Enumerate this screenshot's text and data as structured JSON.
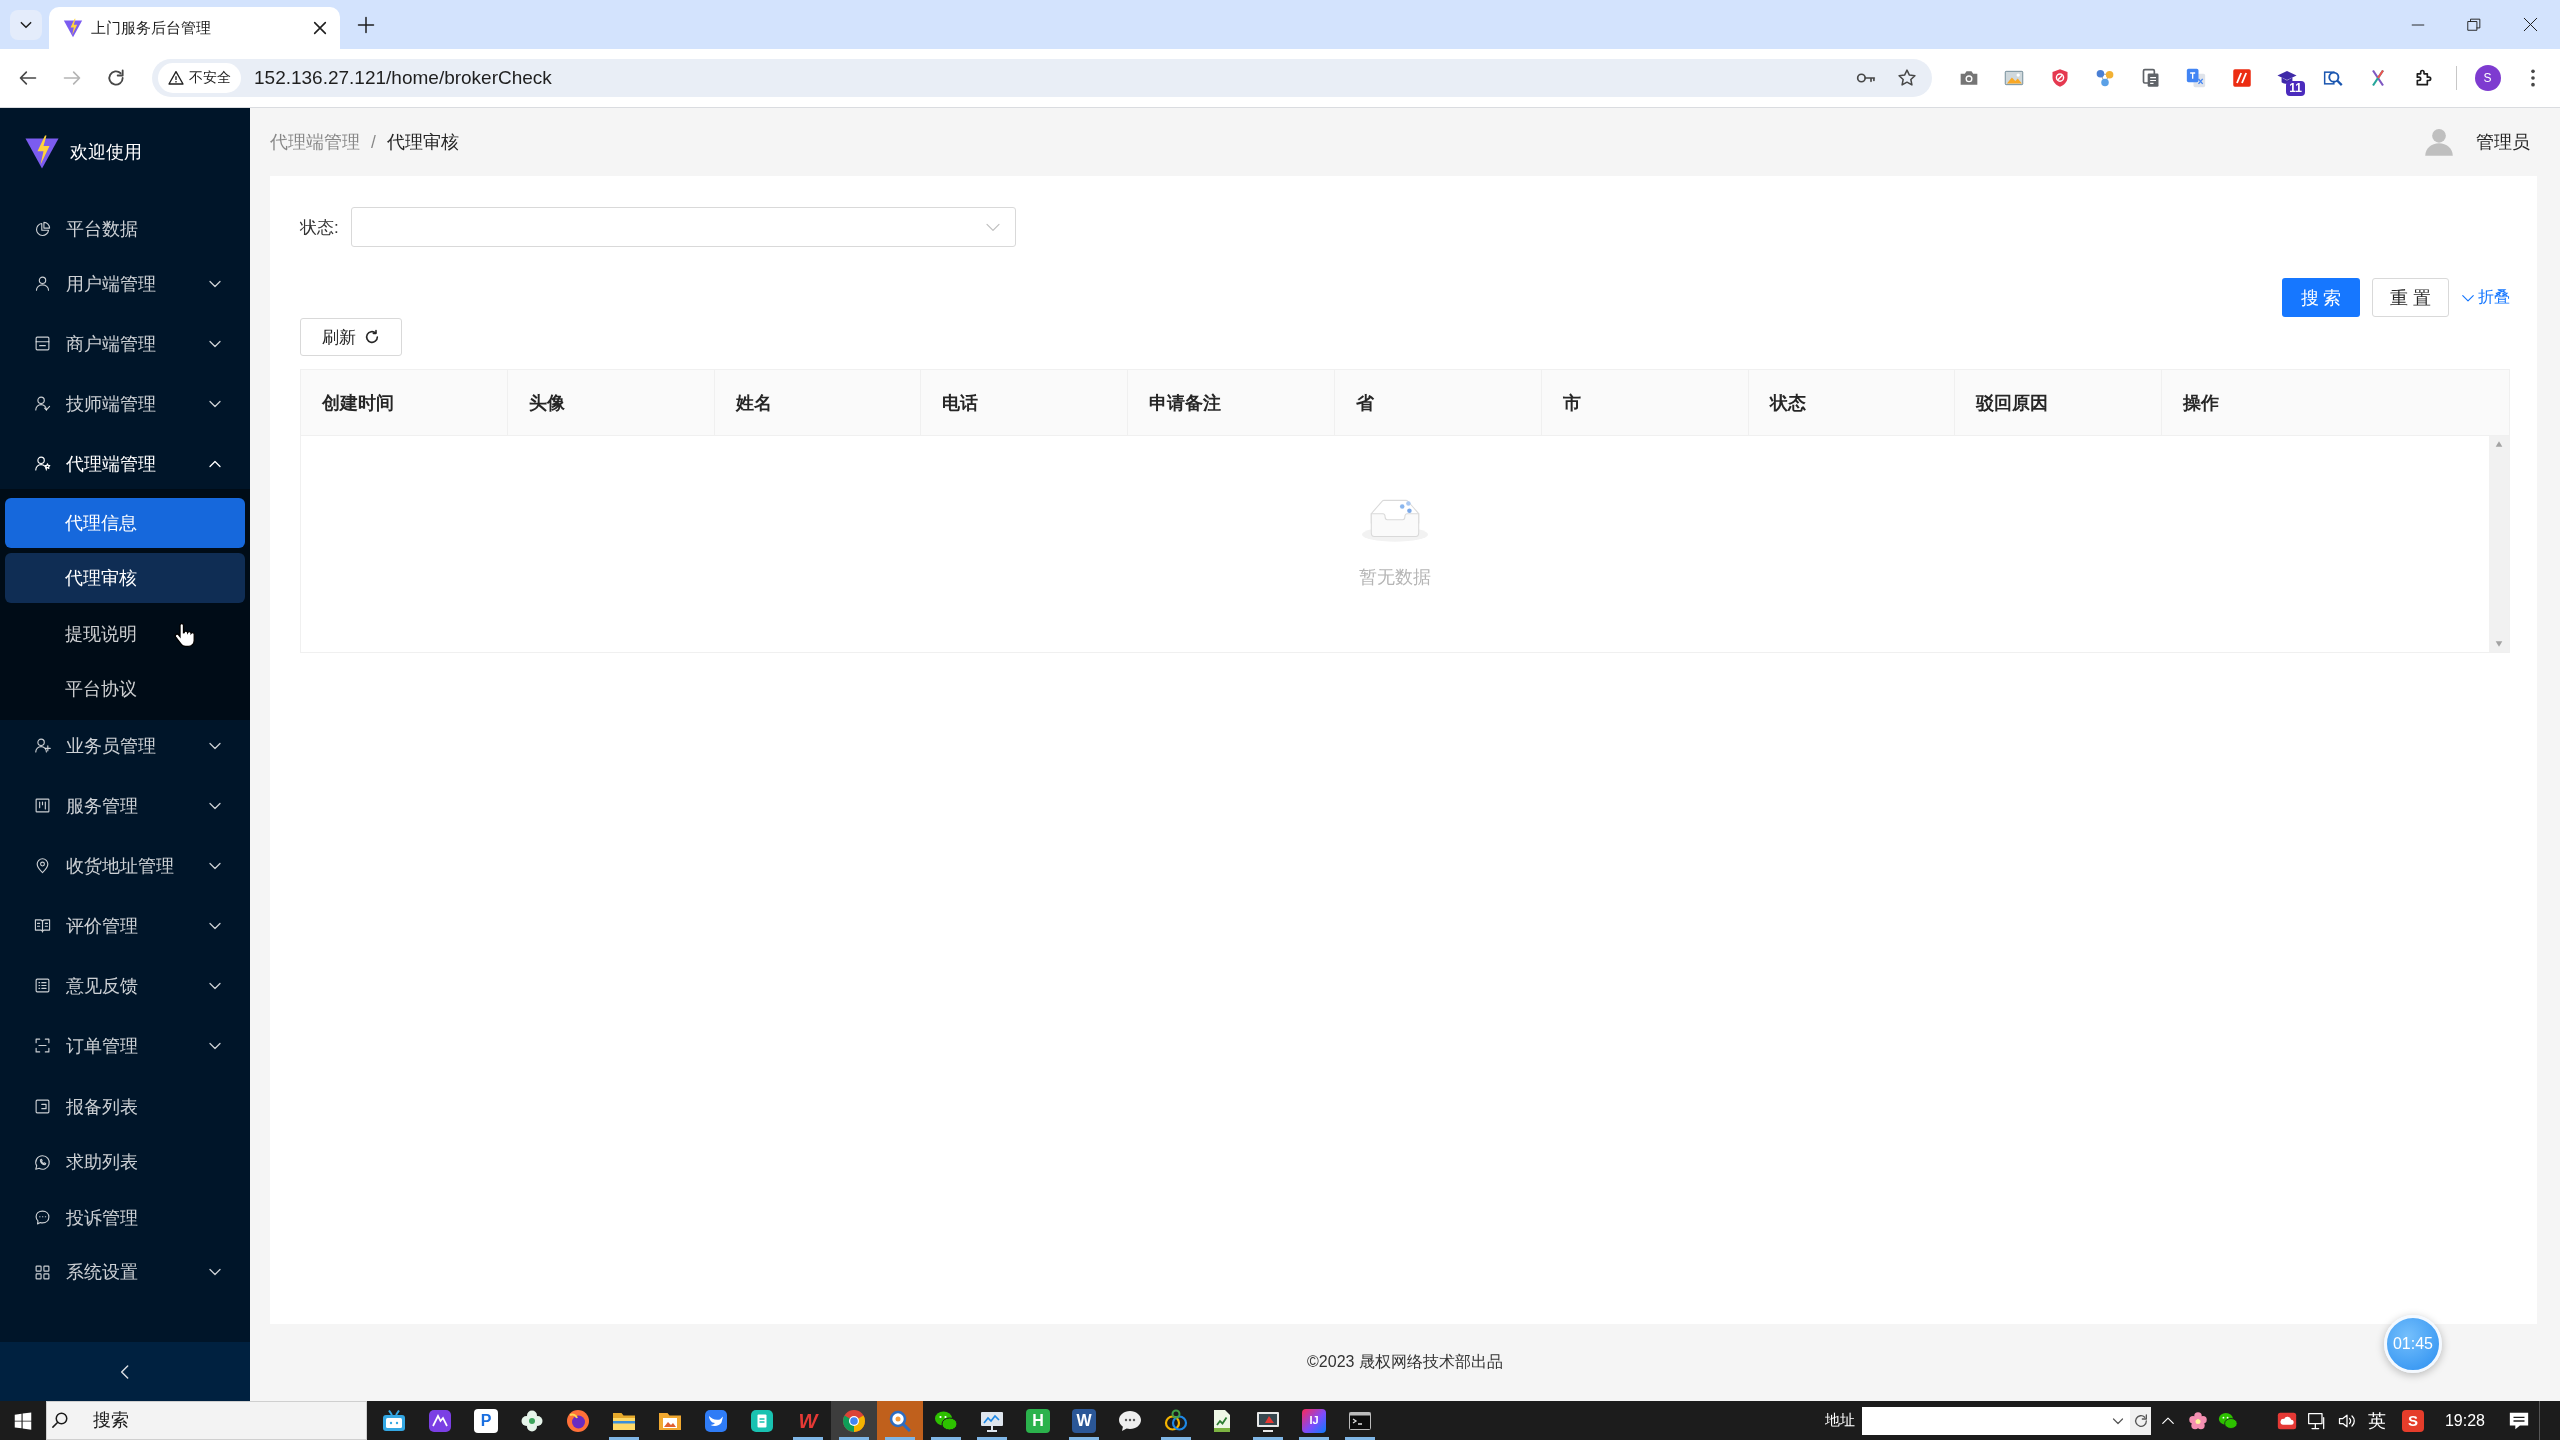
{
  "browser": {
    "tab_title": "上门服务后台管理",
    "security_label": "不安全",
    "url": "152.136.27.121/home/brokerCheck",
    "extension_badge": "11",
    "profile_initial": "S"
  },
  "sidebar": {
    "title": "欢迎使用",
    "items": [
      {
        "kind": "item",
        "label": "平台数据",
        "selected": false
      },
      {
        "kind": "submenu",
        "label": "用户端管理",
        "selected": false,
        "expanded": false
      },
      {
        "kind": "submenu",
        "label": "商户端管理",
        "selected": false,
        "expanded": false
      },
      {
        "kind": "submenu",
        "label": "技师端管理",
        "selected": false,
        "expanded": false
      },
      {
        "kind": "submenu",
        "label": "代理端管理",
        "selected": false,
        "expanded": true,
        "children": [
          {
            "label": "代理信息",
            "selected": true,
            "highlighted": false
          },
          {
            "label": "代理审核",
            "selected": false,
            "highlighted": true
          },
          {
            "label": "提现说明",
            "selected": false,
            "highlighted": false
          },
          {
            "label": "平台协议",
            "selected": false,
            "highlighted": false
          }
        ]
      },
      {
        "kind": "submenu",
        "label": "业务员管理",
        "selected": false,
        "expanded": false
      },
      {
        "kind": "submenu",
        "label": "服务管理",
        "selected": false,
        "expanded": false
      },
      {
        "kind": "submenu",
        "label": "收货地址管理",
        "selected": false,
        "expanded": false
      },
      {
        "kind": "submenu",
        "label": "评价管理",
        "selected": false,
        "expanded": false
      },
      {
        "kind": "submenu",
        "label": "意见反馈",
        "selected": false,
        "expanded": false
      },
      {
        "kind": "submenu",
        "label": "订单管理",
        "selected": false,
        "expanded": false
      },
      {
        "kind": "item",
        "label": "报备列表",
        "selected": false
      },
      {
        "kind": "item",
        "label": "求助列表",
        "selected": false
      },
      {
        "kind": "item",
        "label": "投诉管理",
        "selected": false
      },
      {
        "kind": "submenu",
        "label": "系统设置",
        "selected": false,
        "expanded": false
      }
    ]
  },
  "header": {
    "breadcrumb": [
      "代理端管理",
      "代理审核"
    ],
    "separator": "/",
    "user_name": "管理员"
  },
  "filter": {
    "label": "状态:"
  },
  "actions": {
    "search": "搜 索",
    "reset": "重 置",
    "collapse": "折叠"
  },
  "table_toolbar": {
    "refresh": "刷新"
  },
  "table": {
    "columns": [
      "创建时间",
      "头像",
      "姓名",
      "电话",
      "申请备注",
      "省",
      "市",
      "状态",
      "驳回原因",
      "操作"
    ],
    "empty_text": "暂无数据"
  },
  "footer": {
    "copyright": "©2023 晟权网络技术部出品"
  },
  "timer": {
    "text": "01:45"
  },
  "taskbar": {
    "search": {
      "placeholder": "搜索"
    },
    "apps": [
      {
        "running": false,
        "active": false,
        "flashing": false
      },
      {
        "running": false,
        "active": false,
        "flashing": false
      },
      {
        "label": "P",
        "running": false,
        "active": false,
        "flashing": false
      },
      {
        "running": false,
        "active": false,
        "flashing": false
      },
      {
        "running": false,
        "active": false,
        "flashing": false
      },
      {
        "running": true,
        "active": false,
        "flashing": false
      },
      {
        "running": false,
        "active": false,
        "flashing": false
      },
      {
        "running": false,
        "active": false,
        "flashing": false
      },
      {
        "running": false,
        "active": false,
        "flashing": false
      },
      {
        "label": "W",
        "running": true,
        "active": false,
        "flashing": false
      },
      {
        "running": true,
        "active": true,
        "flashing": false
      },
      {
        "running": true,
        "active": false,
        "flashing": true
      },
      {
        "running": true,
        "active": false,
        "flashing": false
      },
      {
        "running": true,
        "active": false,
        "flashing": false
      },
      {
        "label": "H",
        "running": false,
        "active": false,
        "flashing": false
      },
      {
        "label": "W",
        "running": true,
        "active": false,
        "flashing": false
      },
      {
        "running": false,
        "active": false,
        "flashing": false
      },
      {
        "running": true,
        "active": false,
        "flashing": false
      },
      {
        "running": false,
        "active": false,
        "flashing": false
      },
      {
        "running": true,
        "active": false,
        "flashing": false
      },
      {
        "label": "IJ",
        "running": true,
        "active": false,
        "flashing": false
      },
      {
        "running": true,
        "active": false,
        "flashing": false
      }
    ],
    "address_label": "地址",
    "ime_mode": "英",
    "ime_logo": "S",
    "time": "19:28"
  }
}
